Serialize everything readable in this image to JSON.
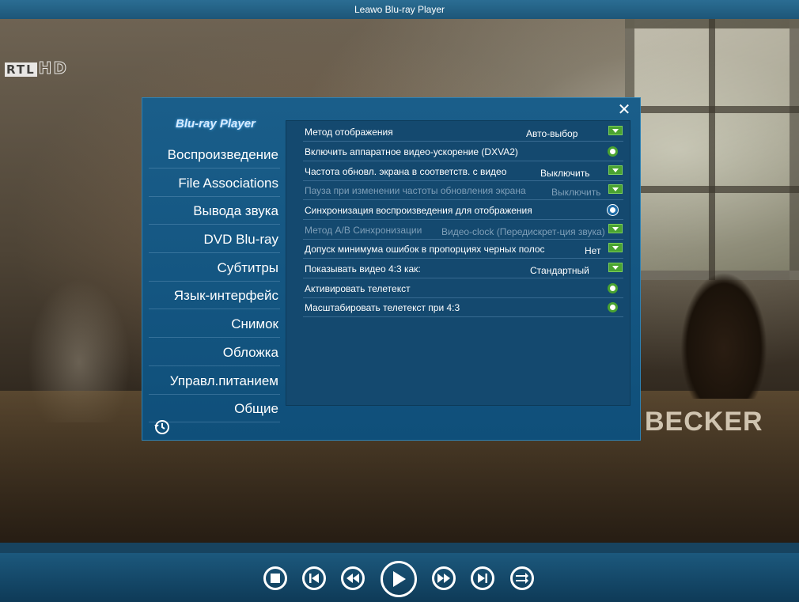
{
  "window": {
    "title": "Leawo Blu-ray Player"
  },
  "video": {
    "channel_logo_box": "RTL",
    "channel_logo_hd": "HD",
    "overlay_text": "BECKER"
  },
  "dialog": {
    "brand": "Blu-ray Player",
    "sidebar": [
      "Воспроизведение",
      "File Associations",
      "Вывода звука",
      "DVD  Blu-ray",
      "Субтитры",
      "Язык-интерфейс",
      "Снимок",
      "Обложка",
      "Управл.питанием",
      "Общие"
    ],
    "settings": [
      {
        "label": "Метод отображения",
        "value": "Авто-выбор",
        "control": "dropdown",
        "enabled": true
      },
      {
        "label": "Включить аппаратное видео-ускорение  (DXVA2)",
        "value": "",
        "control": "radio",
        "enabled": true
      },
      {
        "label": "Частота обновл. экрана в соответств. с видео",
        "value": "Выключить",
        "control": "dropdown",
        "enabled": true
      },
      {
        "label": "Пауза при изменении частоты обновления экрана",
        "value": "Выключить",
        "control": "dropdown",
        "enabled": false
      },
      {
        "label": "Синхронизация воспроизведения для отображения",
        "value": "",
        "control": "radio",
        "enabled": true
      },
      {
        "label": "Метод A/B Синхронизации",
        "value": "Видео-clock (Передискрет-ция звука)",
        "control": "dropdown",
        "enabled": false
      },
      {
        "label": "Допуск минимума ошибок в пропорциях черных полос",
        "value": "Нет",
        "control": "dropdown",
        "enabled": true
      },
      {
        "label": "Показывать видео 4:3 как:",
        "value": "Стандартный",
        "control": "dropdown",
        "enabled": true
      },
      {
        "label": "Активировать телетекст",
        "value": "",
        "control": "radio",
        "enabled": true
      },
      {
        "label": "Масштабировать телетекст при 4:3",
        "value": "",
        "control": "radio",
        "enabled": true
      }
    ]
  },
  "controls": [
    "stop",
    "previous",
    "rewind",
    "play",
    "fast-forward",
    "next",
    "playlist"
  ],
  "colors": {
    "accent_green": "#4aa331",
    "dialog_bg": "#14496f",
    "titlebar": "#2b6d93"
  }
}
